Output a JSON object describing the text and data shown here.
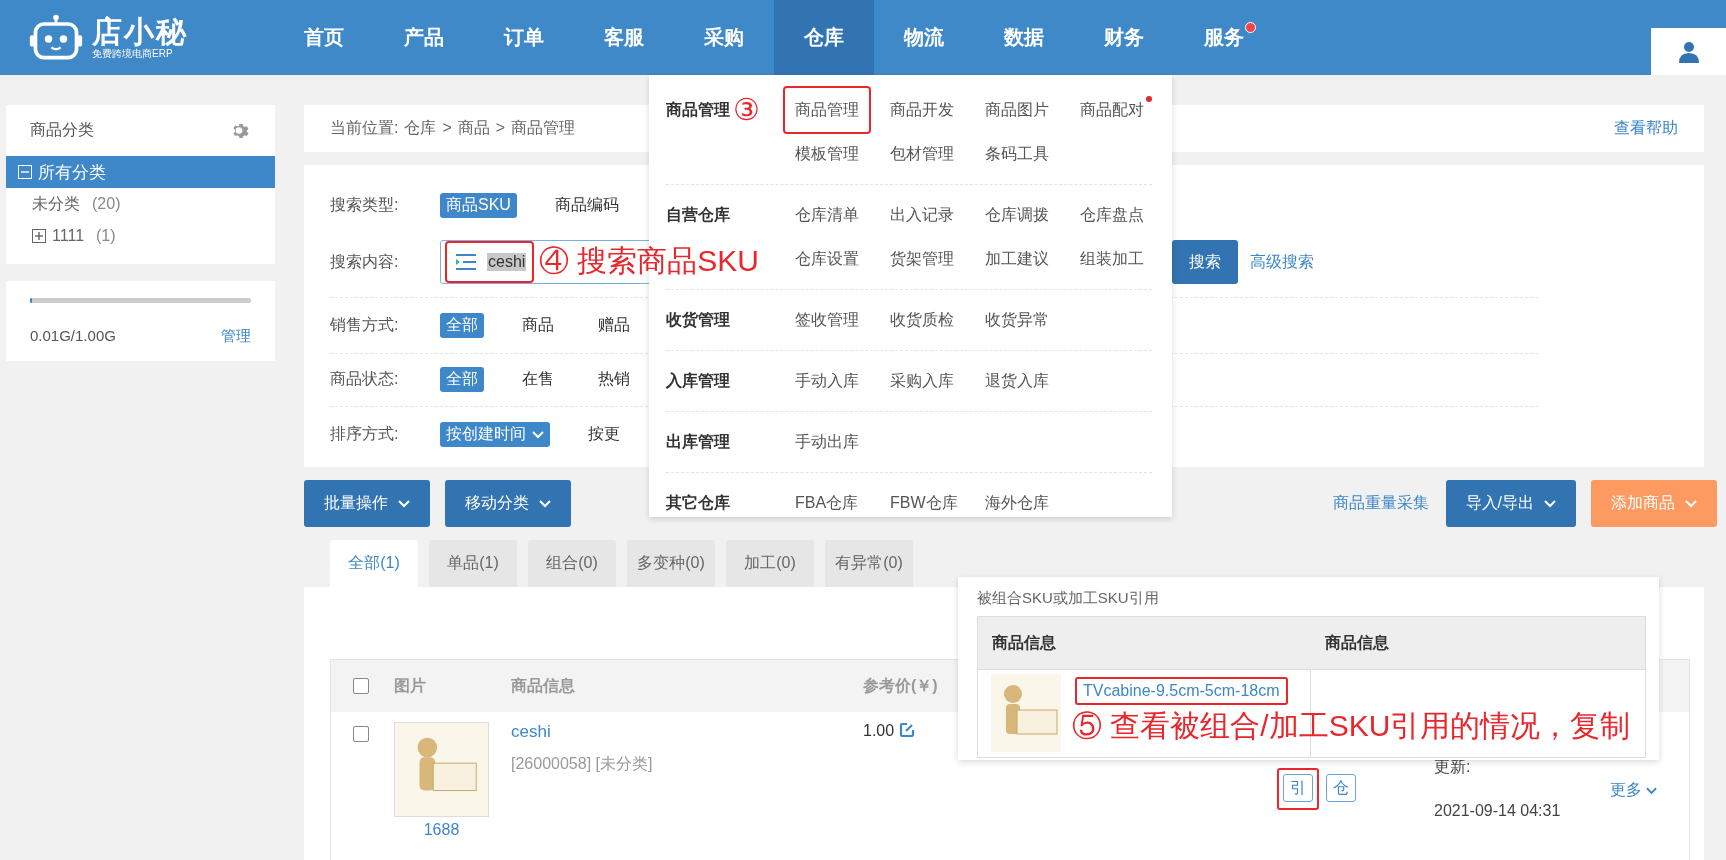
{
  "logo": {
    "name": "店小秘",
    "tagline": "免费跨境电商ERP"
  },
  "nav": [
    {
      "label": "首页",
      "selected": false,
      "badge": false
    },
    {
      "label": "产品",
      "selected": false,
      "badge": false
    },
    {
      "label": "订单",
      "selected": false,
      "badge": false
    },
    {
      "label": "客服",
      "selected": false,
      "badge": false
    },
    {
      "label": "采购",
      "selected": false,
      "badge": false
    },
    {
      "label": "仓库",
      "selected": true,
      "badge": false
    },
    {
      "label": "物流",
      "selected": false,
      "badge": false
    },
    {
      "label": "数据",
      "selected": false,
      "badge": false
    },
    {
      "label": "财务",
      "selected": false,
      "badge": false
    },
    {
      "label": "服务",
      "selected": false,
      "badge": true
    }
  ],
  "sidebar": {
    "title": "商品分类",
    "tree": [
      {
        "label": "所有分类",
        "expanded": true,
        "selected": true,
        "children": [
          {
            "label": "未分类",
            "count": "(20)",
            "selected": false
          },
          {
            "label": "1111",
            "count": "(1)",
            "expanded": false,
            "selected": false
          }
        ]
      }
    ],
    "storage": {
      "level": 0.01,
      "usage": "0.01G/1.00G",
      "action": "管理"
    }
  },
  "breadcrumb": {
    "prefix": "当前位置:",
    "separator": ">",
    "path": [
      "仓库",
      "商品",
      "商品管理"
    ],
    "help": "查看帮助"
  },
  "filters": [
    {
      "label": "搜索类型:",
      "kind": "options",
      "options": [
        {
          "label": "商品SKU",
          "selected": true,
          "dropdown": false
        },
        {
          "label": "商品编码",
          "selected": false,
          "dropdown": false
        }
      ]
    },
    {
      "label": "搜索内容:",
      "kind": "search",
      "value": "ceshi",
      "highlighted": true,
      "marker": "④",
      "note": "搜索商品SKU",
      "button": "搜索",
      "advanced": "高级搜索"
    },
    {
      "label": "销售方式:",
      "kind": "options",
      "options": [
        {
          "label": "全部",
          "selected": true,
          "dropdown": false
        },
        {
          "label": "商品",
          "selected": false,
          "dropdown": false
        },
        {
          "label": "赠品",
          "selected": false,
          "dropdown": false
        }
      ]
    },
    {
      "label": "商品状态:",
      "kind": "options",
      "options": [
        {
          "label": "全部",
          "selected": true,
          "dropdown": false
        },
        {
          "label": "在售",
          "selected": false,
          "dropdown": false
        },
        {
          "label": "热销",
          "selected": false,
          "dropdown": false
        }
      ]
    },
    {
      "label": "排序方式:",
      "kind": "options",
      "options": [
        {
          "label": "按创建时间",
          "selected": true,
          "dropdown": true
        },
        {
          "label": "按更",
          "selected": false,
          "dropdown": false
        }
      ]
    }
  ],
  "actions": {
    "left": [
      "批量操作",
      "移动分类"
    ],
    "link": "商品重量采集",
    "right": [
      {
        "label": "导入/导出",
        "kind": "primary"
      },
      {
        "label": "添加商品",
        "kind": "accent"
      }
    ]
  },
  "tabs": [
    {
      "label": "全部(1)",
      "selected": true
    },
    {
      "label": "单品(1)",
      "selected": false
    },
    {
      "label": "组合(0)",
      "selected": false
    },
    {
      "label": "多变种(0)",
      "selected": false
    },
    {
      "label": "加工(0)",
      "selected": false
    },
    {
      "label": "有异常(0)",
      "selected": false
    }
  ],
  "table": {
    "header_checked": false,
    "columns": [
      "图片",
      "商品信息",
      "参考价(￥)"
    ],
    "rows": [
      {
        "checked": false,
        "source": "1688",
        "name": "ceshi",
        "meta": "[26000058] [未分类]",
        "price": "1.00",
        "ops": [
          {
            "label": "引",
            "highlighted": true
          },
          {
            "label": "仓",
            "highlighted": false
          }
        ],
        "updated_label": "更新:",
        "updated": "2021-09-14 04:31",
        "more": "更多"
      }
    ]
  },
  "menu": {
    "groups": [
      {
        "label": "商品管理",
        "marker": "③",
        "items": [
          {
            "label": "商品管理",
            "highlighted": true,
            "badge": false
          },
          {
            "label": "商品开发",
            "highlighted": false,
            "badge": false
          },
          {
            "label": "商品图片",
            "highlighted": false,
            "badge": false
          },
          {
            "label": "商品配对",
            "highlighted": false,
            "badge": true
          },
          {
            "label": "模板管理",
            "highlighted": false,
            "badge": false
          },
          {
            "label": "包材管理",
            "highlighted": false,
            "badge": false
          },
          {
            "label": "条码工具",
            "highlighted": false,
            "badge": false
          }
        ]
      },
      {
        "label": "自营仓库",
        "items": [
          {
            "label": "仓库清单",
            "highlighted": false,
            "badge": false
          },
          {
            "label": "出入记录",
            "highlighted": false,
            "badge": false
          },
          {
            "label": "仓库调拨",
            "highlighted": false,
            "badge": false
          },
          {
            "label": "仓库盘点",
            "highlighted": false,
            "badge": false
          },
          {
            "label": "仓库设置",
            "highlighted": false,
            "badge": false
          },
          {
            "label": "货架管理",
            "highlighted": false,
            "badge": false
          },
          {
            "label": "加工建议",
            "highlighted": false,
            "badge": false
          },
          {
            "label": "组装加工",
            "highlighted": false,
            "badge": false
          }
        ]
      },
      {
        "label": "收货管理",
        "items": [
          {
            "label": "签收管理",
            "highlighted": false,
            "badge": false
          },
          {
            "label": "收货质检",
            "highlighted": false,
            "badge": false
          },
          {
            "label": "收货异常",
            "highlighted": false,
            "badge": false
          }
        ]
      },
      {
        "label": "入库管理",
        "items": [
          {
            "label": "手动入库",
            "highlighted": false,
            "badge": false
          },
          {
            "label": "采购入库",
            "highlighted": false,
            "badge": false
          },
          {
            "label": "退货入库",
            "highlighted": false,
            "badge": false
          }
        ]
      },
      {
        "label": "出库管理",
        "items": [
          {
            "label": "手动出库",
            "highlighted": false,
            "badge": false
          }
        ]
      },
      {
        "label": "其它仓库",
        "items": [
          {
            "label": "FBA仓库",
            "highlighted": false,
            "badge": false
          },
          {
            "label": "FBW仓库",
            "highlighted": false,
            "badge": false
          },
          {
            "label": "海外仓库",
            "highlighted": false,
            "badge": false
          }
        ]
      }
    ]
  },
  "popup": {
    "title": "被组合SKU或加工SKU引用",
    "columns": [
      "商品信息",
      "商品信息"
    ],
    "rows": [
      {
        "sku": "TVcabine-9.5cm-5cm-18cm",
        "highlighted": true,
        "marker": "⑤",
        "note": "查看被组合/加工SKU引用的情况，复制"
      }
    ]
  }
}
